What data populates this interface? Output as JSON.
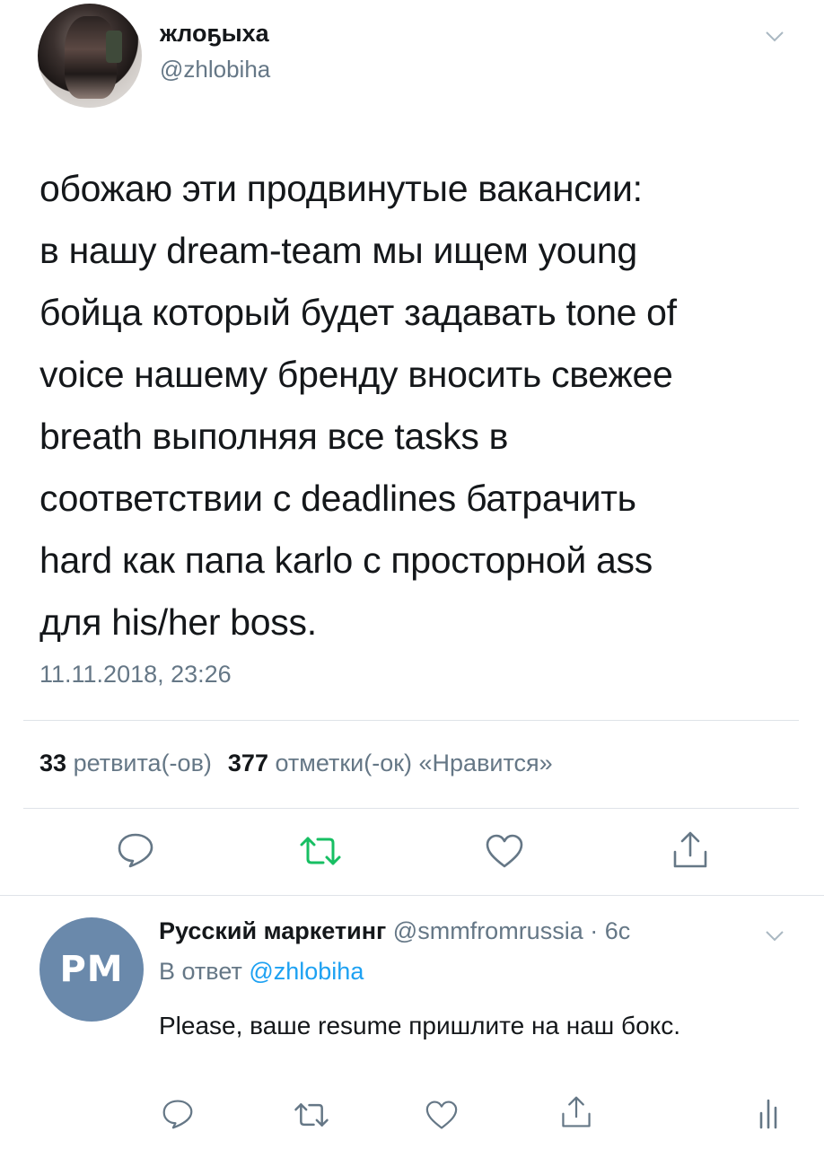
{
  "tweet": {
    "author_name": "жлоҕыха",
    "author_handle": "@zhlobiha",
    "text_lines": [
      "обожаю эти продвинутые вакансии:",
      "в нашу dream-team мы ищем young",
      "бойца который будет задавать tone of",
      "voice нашему бренду вносить свежее",
      "breath выполняя все tasks в",
      "соответствии с deadlines батрачить",
      "hard как папа karlo с просторной ass",
      "для his/her boss."
    ],
    "timestamp": "11.11.2018, 23:26",
    "retweets_count": "33",
    "retweets_label": "ретвита(-ов)",
    "likes_count": "377",
    "likes_label": "отметки(-ок) «Нравится»"
  },
  "reply": {
    "avatar_text": "РМ",
    "author_name": "Русский маркетинг",
    "author_handle": "@smmfromrussia",
    "separator": "·",
    "time": "6с",
    "reply_prefix": "В ответ",
    "reply_mention": "@zhlobiha",
    "text": "Please, ваше resume пришлите на наш бокс."
  },
  "icons": {
    "menu": "chevron-down-icon",
    "reply": "reply-icon",
    "retweet": "retweet-icon",
    "like": "heart-icon",
    "share": "share-icon",
    "analytics": "analytics-icon"
  },
  "colors": {
    "text": "#14171a",
    "secondary": "#657786",
    "link": "#1da1f2",
    "retweet_active": "#17bf63",
    "divider": "#dfe3e8",
    "reply_avatar_bg": "#6a89ab"
  }
}
